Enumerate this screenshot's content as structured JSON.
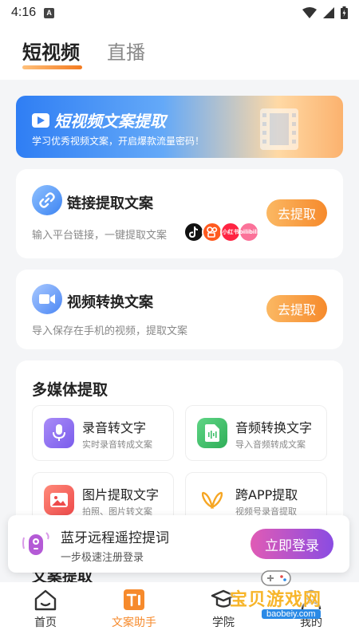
{
  "status_bar": {
    "time": "4:16",
    "badge": "A"
  },
  "top_tabs": [
    {
      "label": "短视频"
    },
    {
      "label": "直播"
    }
  ],
  "banner": {
    "title": "短视频文案提取",
    "subtitle": "学习优秀视频文案，开启爆款流量密码！"
  },
  "link_card": {
    "title": "链接提取文案",
    "desc": "输入平台链接，一键提取文案",
    "button": "去提取",
    "platforms": [
      {
        "name": "douyin-icon",
        "color": "#111111"
      },
      {
        "name": "kuaishou-icon",
        "color": "#ff5a1f"
      },
      {
        "name": "xiaohongshu-icon",
        "color": "#ff2442",
        "text": "小红书"
      },
      {
        "name": "bilibili-icon",
        "color": "#fb7299",
        "text": "bilibili"
      }
    ]
  },
  "video_card": {
    "title": "视频转换文案",
    "desc": "导入保存在手机的视频，提取文案",
    "button": "去提取"
  },
  "multimedia": {
    "title": "多媒体提取",
    "tools": [
      {
        "title": "录音转文字",
        "sub": "实时录音转成文案",
        "icon": "microphone-icon",
        "color": "#8b6cf0"
      },
      {
        "title": "音频转换文字",
        "sub": "导入音频转成文案",
        "icon": "audio-file-icon",
        "color": "#3fbf6a"
      },
      {
        "title": "图片提取文字",
        "sub": "拍照、图片转文案",
        "icon": "image-icon",
        "color": "#f05a5a"
      },
      {
        "title": "跨APP提取",
        "sub": "视频号录音提取",
        "icon": "butterfly-icon",
        "color": "#f6a623"
      }
    ]
  },
  "next_section_title": "文案提取",
  "login_prompt": {
    "title": "蓝牙远程遥控提词",
    "sub": "一步极速注册登录",
    "button": "立即登录"
  },
  "bottom_nav": [
    {
      "label": "首页",
      "icon": "home-icon"
    },
    {
      "label": "文案助手",
      "icon": "text-assistant-icon"
    },
    {
      "label": "学院",
      "icon": "graduation-cap-icon"
    },
    {
      "label": "我的",
      "icon": "profile-icon"
    }
  ],
  "watermark": {
    "text": "宝贝游戏网",
    "url": "baobeiy.com"
  },
  "colors": {
    "accent_orange": "#f68a2c",
    "login_gradient_start": "#e05bb5",
    "login_gradient_end": "#8a4ce2"
  }
}
